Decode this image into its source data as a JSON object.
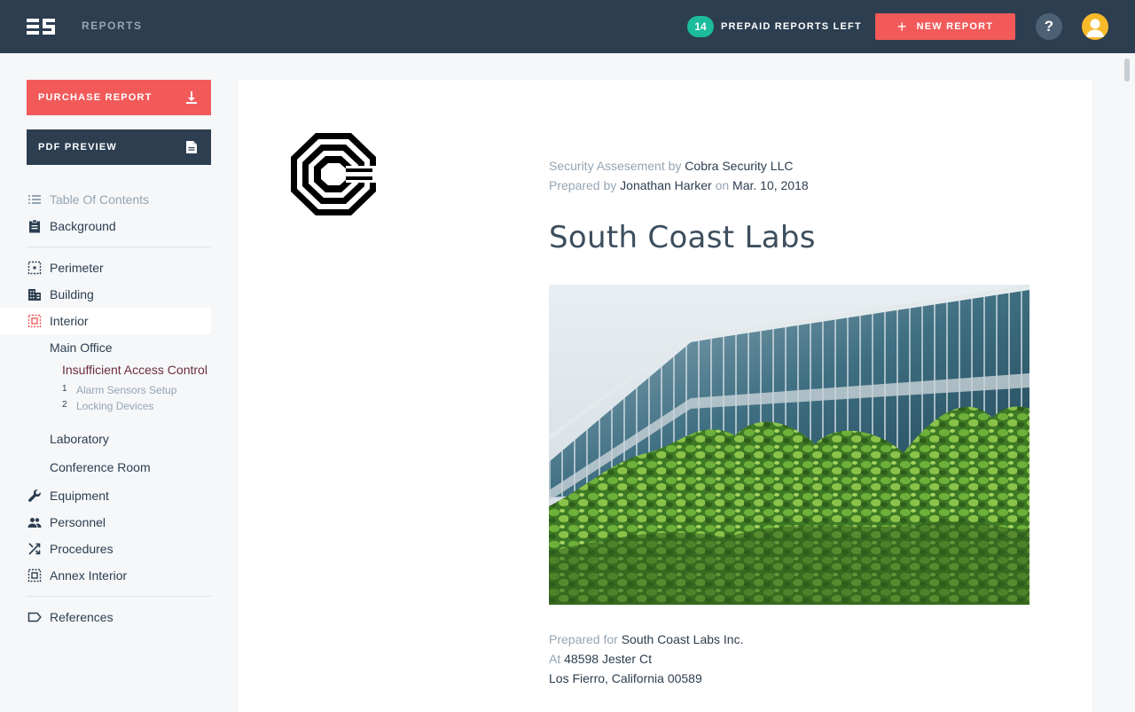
{
  "topbar": {
    "app_title": "REPORTS",
    "credits_count": "14",
    "credits_label": "PREPAID REPORTS LEFT",
    "new_report_label": "NEW REPORT",
    "help_label": "?"
  },
  "sidebar": {
    "purchase_label": "PURCHASE REPORT",
    "pdf_preview_label": "PDF PREVIEW",
    "toc_label": "Table Of Contents",
    "background_label": "Background",
    "perimeter_label": "Perimeter",
    "building_label": "Building",
    "interior_label": "Interior",
    "main_office_label": "Main Office",
    "insufficient_label": "Insufficient Access Control",
    "alarm_num": "1",
    "alarm_label": "Alarm Sensors Setup",
    "locking_num": "2",
    "locking_label": "Locking Devices",
    "laboratory_label": "Laboratory",
    "conference_label": "Conference Room",
    "equipment_label": "Equipment",
    "personnel_label": "Personnel",
    "procedures_label": "Procedures",
    "annex_label": "Annex Interior",
    "references_label": "References"
  },
  "document": {
    "assessment_prefix": "Security Assesement by",
    "assessment_company": "Cobra Security LLC",
    "prepared_by_prefix": "Prepared by",
    "prepared_by_name": "Jonathan Harker",
    "on_label": "on",
    "date": "Mar. 10, 2018",
    "title": "South Coast Labs",
    "prepared_for_prefix": "Prepared for",
    "prepared_for_name": "South Coast Labs Inc.",
    "at_label": "At",
    "address_line1": "48598 Jester Ct",
    "address_line2": "Los Fierro, California 00589"
  },
  "colors": {
    "topbar": "#2c3e50",
    "accent_red": "#f25a5a",
    "credits_green": "#1abc9c",
    "avatar_yellow": "#f6b929"
  }
}
